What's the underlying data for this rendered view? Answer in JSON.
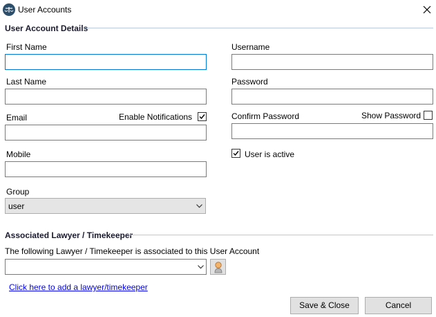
{
  "window": {
    "title": "User Accounts"
  },
  "details": {
    "group_title": "User Account Details",
    "first_name": {
      "label": "First Name",
      "value": ""
    },
    "last_name": {
      "label": "Last Name",
      "value": ""
    },
    "email": {
      "label": "Email",
      "value": ""
    },
    "enable_notifications": {
      "label": "Enable Notifications",
      "checked": true
    },
    "mobile": {
      "label": "Mobile",
      "value": ""
    },
    "group": {
      "label": "Group",
      "selected": "user"
    },
    "username": {
      "label": "Username",
      "value": ""
    },
    "password": {
      "label": "Password",
      "value": ""
    },
    "confirm_password": {
      "label": "Confirm Password",
      "value": ""
    },
    "show_password": {
      "label": "Show Password",
      "checked": false
    },
    "user_active": {
      "label": "User is active",
      "checked": true
    }
  },
  "lawyer": {
    "group_title": "Associated Lawyer / Timekeeper",
    "description": "The following Lawyer / Timekeeper is associated to this User Account",
    "selected": "",
    "add_link": "Click here to add a lawyer/timekeeper"
  },
  "buttons": {
    "save_close": "Save & Close",
    "cancel": "Cancel"
  }
}
